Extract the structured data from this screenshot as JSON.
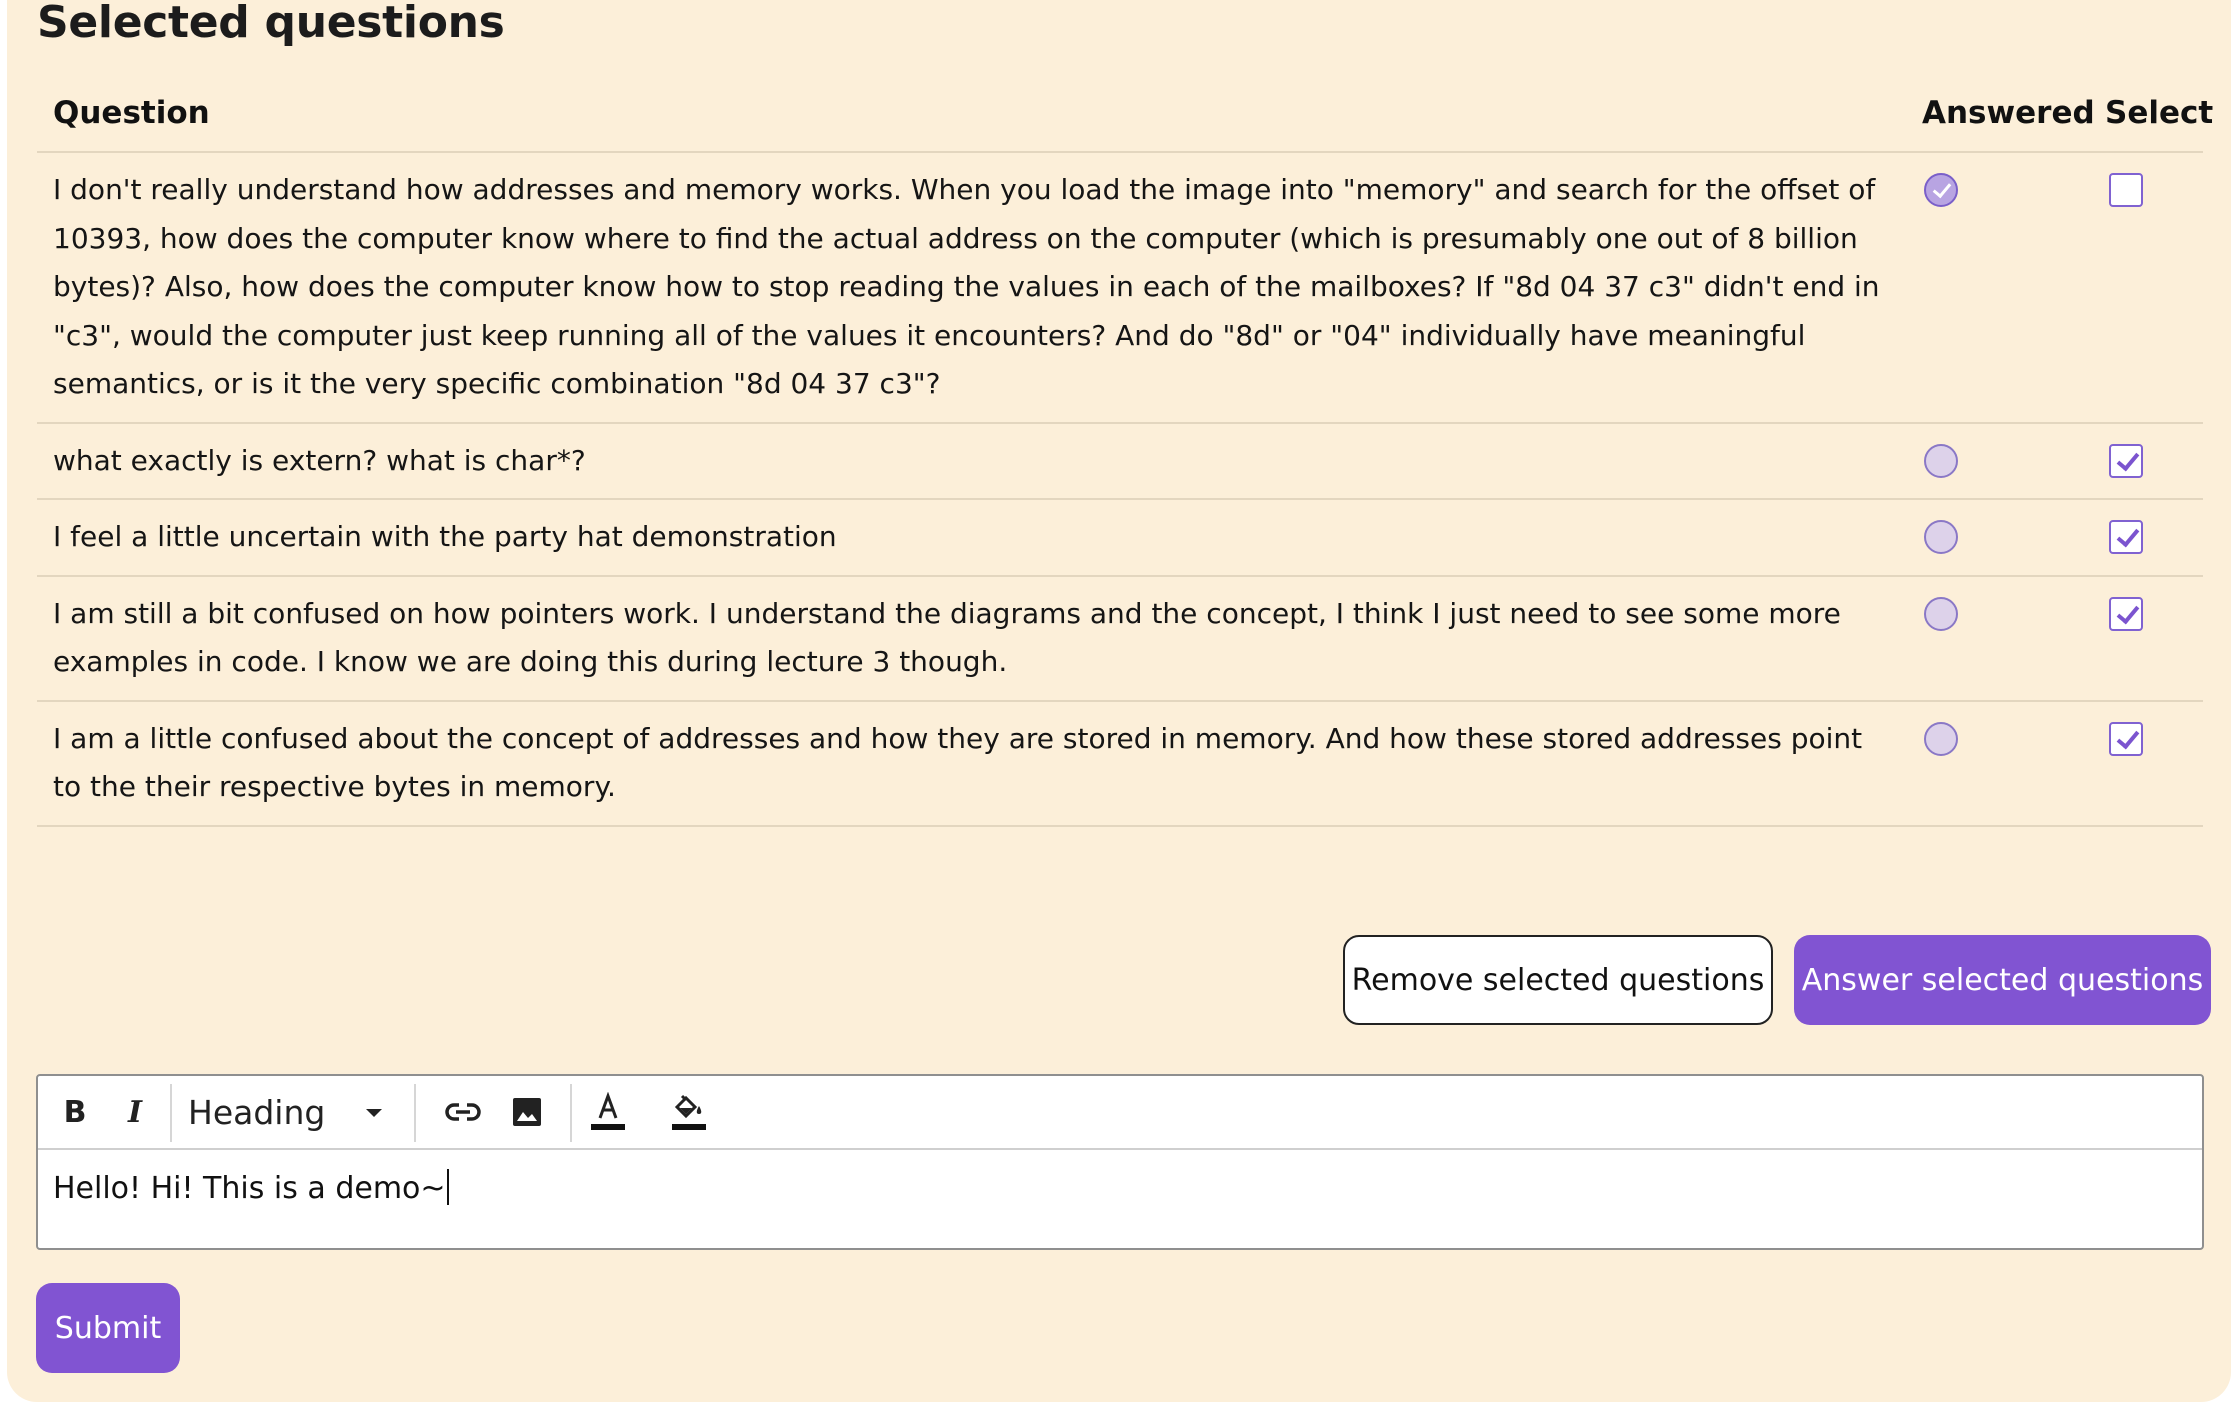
{
  "page": {
    "title": "Selected questions"
  },
  "table": {
    "headers": {
      "question": "Question",
      "answered": "Answered",
      "select": "Select"
    },
    "rows": [
      {
        "question": "I don't really understand how addresses and memory works. When you load the image into \"memory\" and search for the offset of 10393, how does the computer know where to find the actual address on the computer (which is presumably one out of 8 billion bytes)? Also, how does the computer know how to stop reading the values in each of the mailboxes? If \"8d 04 37 c3\" didn't end in \"c3\", would the computer just keep running all of the values it encounters? And do \"8d\" or \"04\" individually have meaningful semantics, or is it the very specific combination \"8d 04 37 c3\"?",
        "answered": true,
        "selected": false
      },
      {
        "question": "what exactly is extern? what is char*?",
        "answered": false,
        "selected": true
      },
      {
        "question": "I feel a little uncertain with the party hat demonstration",
        "answered": false,
        "selected": true
      },
      {
        "question": "I am still a bit confused on how pointers work. I understand the diagrams and the concept, I think I just need to see some more examples in code. I know we are doing this during lecture 3 though.",
        "answered": false,
        "selected": true
      },
      {
        "question": "I am a little confused about the concept of addresses and how they are stored in memory. And how these stored addresses point to the their respective bytes in memory.",
        "answered": false,
        "selected": true
      }
    ]
  },
  "actions": {
    "remove_label": "Remove selected questions",
    "answer_label": "Answer selected questions"
  },
  "editor": {
    "toolbar": {
      "bold_label": "B",
      "italic_label": "I",
      "heading_label": "Heading",
      "font_color_label": "A",
      "icons": [
        "bold-icon",
        "italic-icon",
        "chevron-down-icon",
        "link-icon",
        "image-icon",
        "font-color-icon",
        "fill-color-icon"
      ]
    },
    "content": "Hello! Hi! This is a demo~"
  },
  "submit_label": "Submit",
  "colors": {
    "background": "#fcefd9",
    "accent": "#8154d2",
    "border": "#e3d6bf"
  }
}
